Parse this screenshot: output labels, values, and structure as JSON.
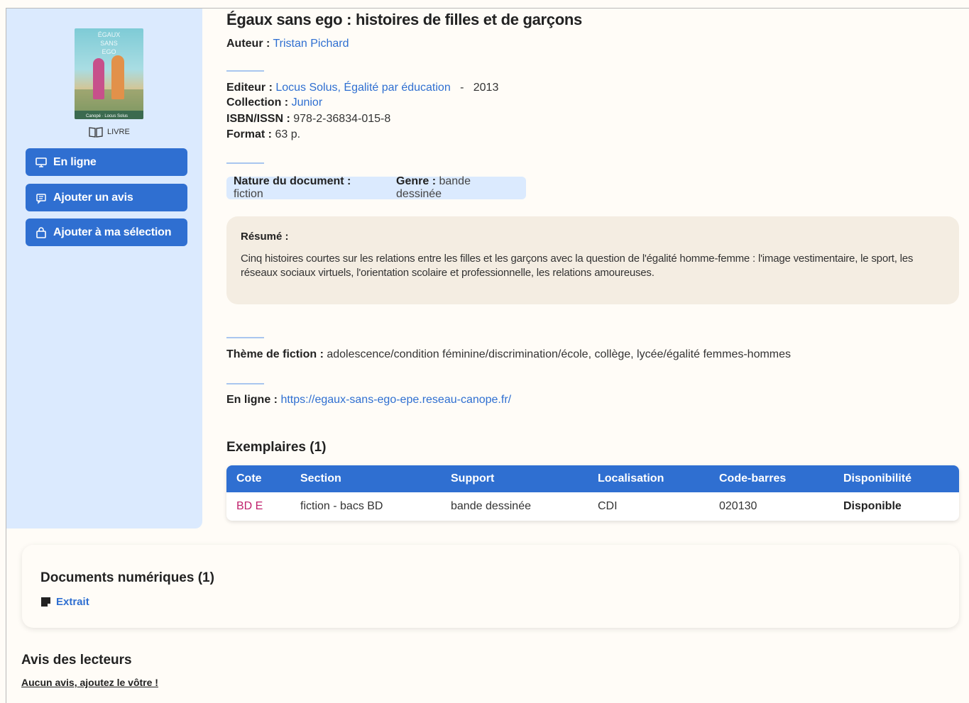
{
  "sidebar": {
    "cover": {
      "title_lines": [
        "ÉGAUX",
        "SANS",
        "EGO"
      ],
      "footer_text": "Canopé · Locus Solus"
    },
    "doc_type": "LIVRE",
    "buttons": [
      {
        "label": "En ligne",
        "icon": "monitor-icon"
      },
      {
        "label": "Ajouter un avis",
        "icon": "comment-icon"
      },
      {
        "label": "Ajouter à ma sélection",
        "icon": "bag-icon"
      }
    ]
  },
  "record": {
    "title": "Égaux sans ego : histoires de filles et de garçons",
    "author_label": "Auteur :",
    "author": "Tristan Pichard",
    "publisher_label": "Editeur :",
    "publisher": "Locus Solus, Égalité par éducation",
    "year_sep": "-",
    "year": "2013",
    "collection_label": "Collection :",
    "collection": "Junior",
    "isbn_label": "ISBN/ISSN :",
    "isbn": "978-2-36834-015-8",
    "format_label": "Format :",
    "format": "63 p.",
    "nature_label": "Nature du document :",
    "nature": "fiction",
    "genre_label": "Genre :",
    "genre": "bande dessinée",
    "resume_label": "Résumé :",
    "resume": "Cinq histoires courtes sur les relations entre les filles et les garçons avec la question de l'égalité homme-femme : l'image vestimentaire, le sport, les réseaux sociaux virtuels, l'orientation scolaire et professionnelle, les relations amoureuses.",
    "theme_label": "Thème de fiction :",
    "theme": "adolescence/condition féminine/discrimination/école, collège, lycée/égalité femmes-hommes",
    "online_label": "En ligne :",
    "online_url": "https://egaux-sans-ego-epe.reseau-canope.fr/"
  },
  "exemplaires": {
    "title": "Exemplaires (1)",
    "columns": [
      "Cote",
      "Section",
      "Support",
      "Localisation",
      "Code-barres",
      "Disponibilité"
    ],
    "rows": [
      [
        "BD E",
        "fiction - bacs BD",
        "bande dessinée",
        "CDI",
        "020130",
        "Disponible"
      ]
    ]
  },
  "docs_numeriques": {
    "title": "Documents numériques (1)",
    "link": "Extrait"
  },
  "avis": {
    "title": "Avis des lecteurs",
    "link": "Aucun avis, ajoutez le vôtre !"
  }
}
